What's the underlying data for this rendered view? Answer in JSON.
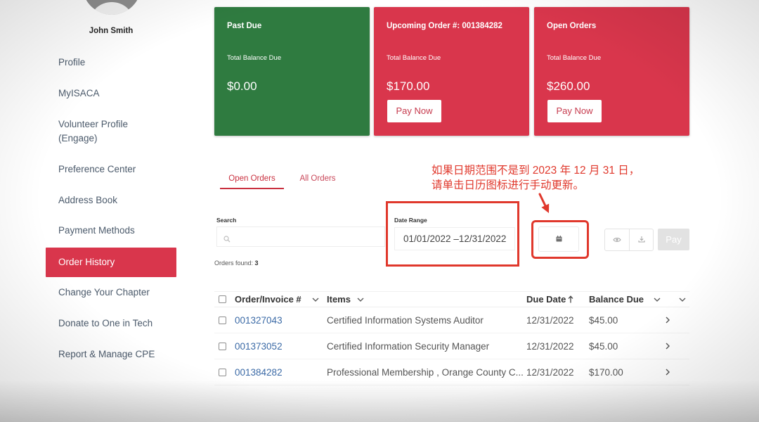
{
  "user": {
    "name": "John Smith"
  },
  "sidebar": {
    "items": [
      {
        "label": "Profile",
        "active": false
      },
      {
        "label": "MyISACA",
        "active": false
      },
      {
        "label": "Volunteer Profile (Engage)",
        "active": false
      },
      {
        "label": "Preference Center",
        "active": false
      },
      {
        "label": "Address Book",
        "active": false
      },
      {
        "label": "Payment Methods",
        "active": false
      },
      {
        "label": "Order History",
        "active": true
      },
      {
        "label": "Change Your Chapter",
        "active": false
      },
      {
        "label": "Donate to One in Tech",
        "active": false
      },
      {
        "label": "Report & Manage CPE",
        "active": false
      }
    ]
  },
  "cards": [
    {
      "title": "Past Due",
      "subtitle": "Total Balance Due",
      "amount": "$0.00",
      "color": "#2f7b40"
    },
    {
      "title": "Upcoming Order #: 001384282",
      "subtitle": "Total Balance Due",
      "amount": "$170.00",
      "button_label": "Pay Now",
      "color": "#d9364c"
    },
    {
      "title": "Open Orders",
      "subtitle": "Total Balance Due",
      "amount": "$260.00",
      "button_label": "Pay Now",
      "color": "#d9364c"
    }
  ],
  "tabs": [
    {
      "label": "Open Orders",
      "active": true
    },
    {
      "label": "All Orders",
      "active": false
    }
  ],
  "annotation": {
    "lines": [
      "如果日期范围不是到 2023 年 12 月 31 日，",
      "请单击日历图标进行手动更新。"
    ],
    "color": "#e0382c"
  },
  "filters": {
    "search": {
      "label": "Search",
      "value": "",
      "icon": "search-icon"
    },
    "date_range": {
      "label": "Date Range",
      "value": "01/01/2022 –12/31/2022",
      "icon": "calendar-icon"
    },
    "actions": {
      "view_icon": "eye-icon",
      "download_icon": "download-icon",
      "pay_label": "Pay",
      "pay_enabled": false
    }
  },
  "orders_found": {
    "label": "Orders found:",
    "count": 3
  },
  "table": {
    "columns": [
      {
        "label": "Order/Invoice #",
        "icon": "chevron-down-icon"
      },
      {
        "label": "Items",
        "icon": "chevron-down-icon"
      },
      {
        "label": "Due Date",
        "icon": "arrow-up-icon"
      },
      {
        "label": "Balance Due",
        "icon": "chevron-down-icon"
      }
    ],
    "rows": [
      {
        "order": "001327043",
        "items": "Certified Information Systems Auditor",
        "due_date": "12/31/2022",
        "balance": "$45.00"
      },
      {
        "order": "001373052",
        "items": "Certified Information Security Manager",
        "due_date": "12/31/2022",
        "balance": "$45.00"
      },
      {
        "order": "001384282",
        "items": "Professional Membership , Orange County C...",
        "due_date": "12/31/2022",
        "balance": "$170.00"
      }
    ],
    "row_icon": "chevron-right-icon"
  },
  "colors": {
    "brand_red": "#d9364c",
    "past_due_green": "#2f7b40",
    "link_blue": "#3b6aa6"
  }
}
